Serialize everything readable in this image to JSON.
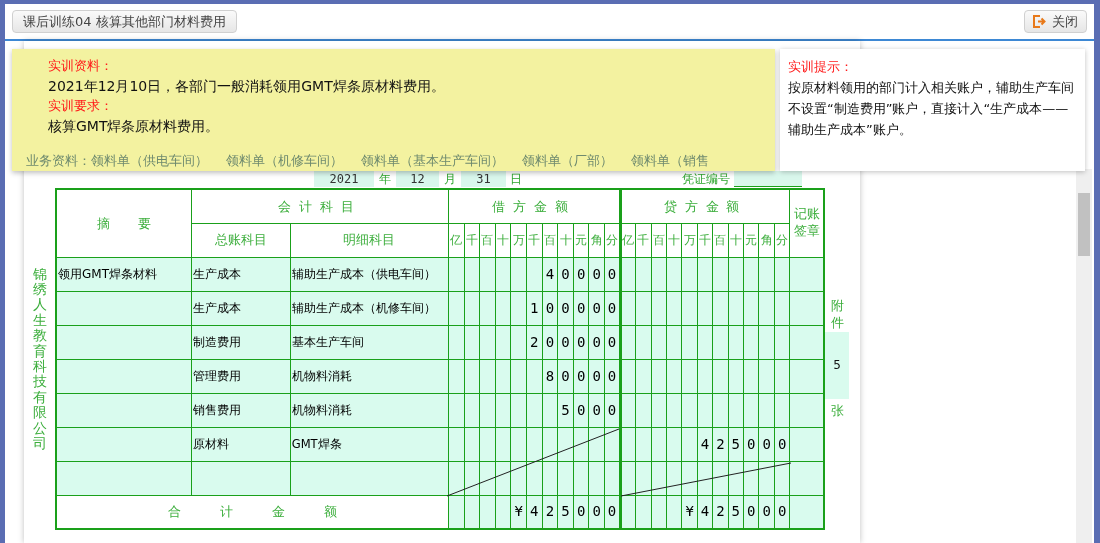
{
  "window": {
    "title": "课后训练04 核算其他部门材料费用",
    "close_button": "关闭"
  },
  "material": {
    "heading": "实训资料：",
    "text": "2021年12月10日，各部门一般消耗领用GMT焊条原材料费用。",
    "requirement_heading": "实训要求：",
    "requirement": "核算GMT焊条原材料费用。",
    "business_label": "业务资料：",
    "business_links": [
      "领料单（供电车间）",
      "领料单（机修车间）",
      "领料单（基本生产车间）",
      "领料单（厂部）",
      "领料单（销售"
    ]
  },
  "hint": {
    "heading": "实训提示：",
    "text": "按原材料领用的部门计入相关账户，辅助生产车间不设置“制造费用”账户，直接计入“生产成本——辅助生产成本”账户。"
  },
  "voucher": {
    "year": "2021",
    "year_label": "年",
    "month": "12",
    "month_label": "月",
    "day": "31",
    "day_label": "日",
    "number_label": "凭证编号",
    "company": "锦绣人生教育科技有限公司",
    "attachment_label_top": "附件",
    "attachment_count": "5",
    "attachment_label_bottom": "张",
    "table": {
      "summary_header": "摘要",
      "accounts_header": "会计科目",
      "general_header": "总账科目",
      "detail_header": "明细科目",
      "debit_header": "借方金额",
      "credit_header": "贷方金额",
      "sign_header": "记账签章",
      "debit_units": [
        "亿",
        "千",
        "百",
        "十",
        "万",
        "千",
        "百",
        "十",
        "元",
        "角",
        "分"
      ],
      "credit_units": [
        "亿",
        "千",
        "百",
        "十",
        "万",
        "千",
        "百",
        "十",
        "元",
        "角",
        "分"
      ],
      "rows": [
        {
          "summary": "领用GMT焊条材料",
          "account": "生产成本",
          "detail": "辅助生产成本（供电车间）",
          "debit": [
            "4",
            "0",
            "0",
            "0",
            "0"
          ]
        },
        {
          "account": "生产成本",
          "detail": "辅助生产成本（机修车间）",
          "debit": [
            "1",
            "0",
            "0",
            "0",
            "0",
            "0"
          ]
        },
        {
          "account": "制造费用",
          "detail": "基本生产车间",
          "debit": [
            "2",
            "0",
            "0",
            "0",
            "0",
            "0"
          ]
        },
        {
          "account": "管理费用",
          "detail": "机物料消耗",
          "debit": [
            "8",
            "0",
            "0",
            "0",
            "0"
          ]
        },
        {
          "account": "销售费用",
          "detail": "机物料消耗",
          "debit": [
            "5",
            "0",
            "0",
            "0"
          ]
        },
        {
          "account": "原材料",
          "detail": "GMT焊条",
          "credit": [
            "4",
            "2",
            "5",
            "0",
            "0",
            "0"
          ]
        },
        {}
      ],
      "debit_void": true,
      "credit_void": true,
      "total_label": "合计金额",
      "debit_total": [
        "¥",
        "4",
        "2",
        "5",
        "0",
        "0",
        "0"
      ],
      "credit_total": [
        "¥",
        "4",
        "2",
        "5",
        "0",
        "0",
        "0"
      ]
    }
  }
}
